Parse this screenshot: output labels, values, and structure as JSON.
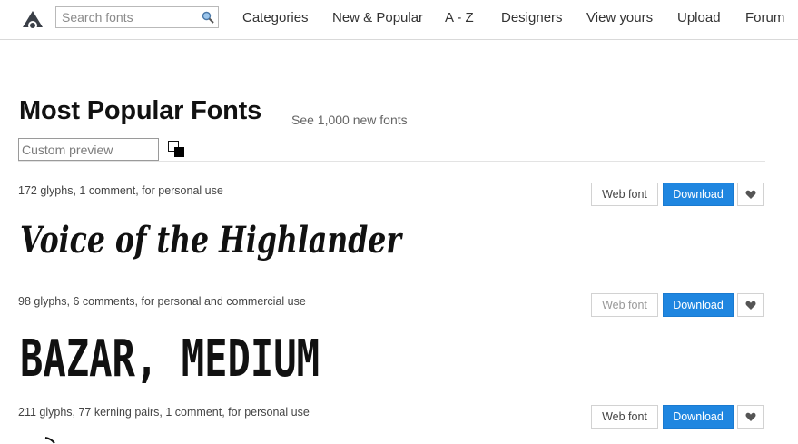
{
  "nav": {
    "search_placeholder": "Search fonts",
    "items": [
      "Categories",
      "New & Popular",
      "A - Z",
      "Designers",
      "View yours",
      "Upload",
      "Forum"
    ]
  },
  "header": {
    "title": "Most Popular Fonts",
    "see_new": "See 1,000 new fonts",
    "custom_preview_placeholder": "Custom preview"
  },
  "fonts": [
    {
      "meta": "172 glyphs, 1 comment, for personal use",
      "sample": "Voice of the Highlander",
      "web_font": "Web font",
      "download": "Download"
    },
    {
      "meta": "98 glyphs, 6 comments, for personal and commercial use",
      "sample": "BAZAR, MEDIUM",
      "web_font": "Web font",
      "download": "Download"
    },
    {
      "meta": "211 glyphs, 77 kerning pairs, 1 comment, for personal use",
      "web_font": "Web font",
      "download": "Download"
    }
  ],
  "colors": {
    "accent": "#1f86e0",
    "logo": "#3a3f47"
  },
  "icons": {
    "logo": "site-logo-icon",
    "search": "magnifier-icon",
    "color_swap": "color-swap-icon",
    "favorite": "heart-icon"
  }
}
